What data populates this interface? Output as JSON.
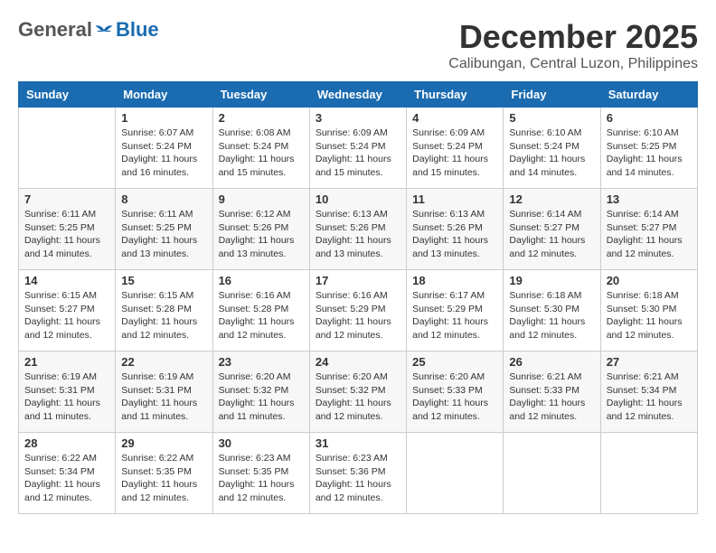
{
  "header": {
    "logo_general": "General",
    "logo_blue": "Blue",
    "month_title": "December 2025",
    "location": "Calibungan, Central Luzon, Philippines"
  },
  "weekdays": [
    "Sunday",
    "Monday",
    "Tuesday",
    "Wednesday",
    "Thursday",
    "Friday",
    "Saturday"
  ],
  "weeks": [
    [
      {
        "day": "",
        "info": ""
      },
      {
        "day": "1",
        "info": "Sunrise: 6:07 AM\nSunset: 5:24 PM\nDaylight: 11 hours\nand 16 minutes."
      },
      {
        "day": "2",
        "info": "Sunrise: 6:08 AM\nSunset: 5:24 PM\nDaylight: 11 hours\nand 15 minutes."
      },
      {
        "day": "3",
        "info": "Sunrise: 6:09 AM\nSunset: 5:24 PM\nDaylight: 11 hours\nand 15 minutes."
      },
      {
        "day": "4",
        "info": "Sunrise: 6:09 AM\nSunset: 5:24 PM\nDaylight: 11 hours\nand 15 minutes."
      },
      {
        "day": "5",
        "info": "Sunrise: 6:10 AM\nSunset: 5:24 PM\nDaylight: 11 hours\nand 14 minutes."
      },
      {
        "day": "6",
        "info": "Sunrise: 6:10 AM\nSunset: 5:25 PM\nDaylight: 11 hours\nand 14 minutes."
      }
    ],
    [
      {
        "day": "7",
        "info": "Sunrise: 6:11 AM\nSunset: 5:25 PM\nDaylight: 11 hours\nand 14 minutes."
      },
      {
        "day": "8",
        "info": "Sunrise: 6:11 AM\nSunset: 5:25 PM\nDaylight: 11 hours\nand 13 minutes."
      },
      {
        "day": "9",
        "info": "Sunrise: 6:12 AM\nSunset: 5:26 PM\nDaylight: 11 hours\nand 13 minutes."
      },
      {
        "day": "10",
        "info": "Sunrise: 6:13 AM\nSunset: 5:26 PM\nDaylight: 11 hours\nand 13 minutes."
      },
      {
        "day": "11",
        "info": "Sunrise: 6:13 AM\nSunset: 5:26 PM\nDaylight: 11 hours\nand 13 minutes."
      },
      {
        "day": "12",
        "info": "Sunrise: 6:14 AM\nSunset: 5:27 PM\nDaylight: 11 hours\nand 12 minutes."
      },
      {
        "day": "13",
        "info": "Sunrise: 6:14 AM\nSunset: 5:27 PM\nDaylight: 11 hours\nand 12 minutes."
      }
    ],
    [
      {
        "day": "14",
        "info": "Sunrise: 6:15 AM\nSunset: 5:27 PM\nDaylight: 11 hours\nand 12 minutes."
      },
      {
        "day": "15",
        "info": "Sunrise: 6:15 AM\nSunset: 5:28 PM\nDaylight: 11 hours\nand 12 minutes."
      },
      {
        "day": "16",
        "info": "Sunrise: 6:16 AM\nSunset: 5:28 PM\nDaylight: 11 hours\nand 12 minutes."
      },
      {
        "day": "17",
        "info": "Sunrise: 6:16 AM\nSunset: 5:29 PM\nDaylight: 11 hours\nand 12 minutes."
      },
      {
        "day": "18",
        "info": "Sunrise: 6:17 AM\nSunset: 5:29 PM\nDaylight: 11 hours\nand 12 minutes."
      },
      {
        "day": "19",
        "info": "Sunrise: 6:18 AM\nSunset: 5:30 PM\nDaylight: 11 hours\nand 12 minutes."
      },
      {
        "day": "20",
        "info": "Sunrise: 6:18 AM\nSunset: 5:30 PM\nDaylight: 11 hours\nand 12 minutes."
      }
    ],
    [
      {
        "day": "21",
        "info": "Sunrise: 6:19 AM\nSunset: 5:31 PM\nDaylight: 11 hours\nand 11 minutes."
      },
      {
        "day": "22",
        "info": "Sunrise: 6:19 AM\nSunset: 5:31 PM\nDaylight: 11 hours\nand 11 minutes."
      },
      {
        "day": "23",
        "info": "Sunrise: 6:20 AM\nSunset: 5:32 PM\nDaylight: 11 hours\nand 11 minutes."
      },
      {
        "day": "24",
        "info": "Sunrise: 6:20 AM\nSunset: 5:32 PM\nDaylight: 11 hours\nand 12 minutes."
      },
      {
        "day": "25",
        "info": "Sunrise: 6:20 AM\nSunset: 5:33 PM\nDaylight: 11 hours\nand 12 minutes."
      },
      {
        "day": "26",
        "info": "Sunrise: 6:21 AM\nSunset: 5:33 PM\nDaylight: 11 hours\nand 12 minutes."
      },
      {
        "day": "27",
        "info": "Sunrise: 6:21 AM\nSunset: 5:34 PM\nDaylight: 11 hours\nand 12 minutes."
      }
    ],
    [
      {
        "day": "28",
        "info": "Sunrise: 6:22 AM\nSunset: 5:34 PM\nDaylight: 11 hours\nand 12 minutes."
      },
      {
        "day": "29",
        "info": "Sunrise: 6:22 AM\nSunset: 5:35 PM\nDaylight: 11 hours\nand 12 minutes."
      },
      {
        "day": "30",
        "info": "Sunrise: 6:23 AM\nSunset: 5:35 PM\nDaylight: 11 hours\nand 12 minutes."
      },
      {
        "day": "31",
        "info": "Sunrise: 6:23 AM\nSunset: 5:36 PM\nDaylight: 11 hours\nand 12 minutes."
      },
      {
        "day": "",
        "info": ""
      },
      {
        "day": "",
        "info": ""
      },
      {
        "day": "",
        "info": ""
      }
    ]
  ]
}
